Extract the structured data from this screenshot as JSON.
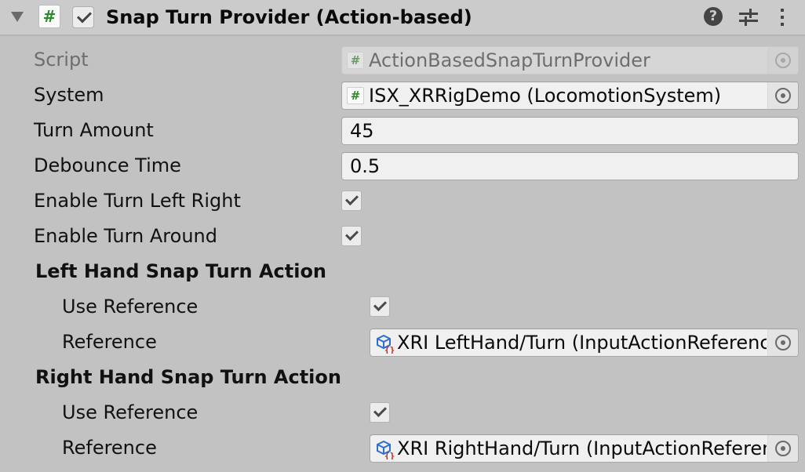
{
  "component": {
    "title": "Snap Turn Provider (Action-based)",
    "enabled": true,
    "expanded": true,
    "icons": {
      "foldout": "triangle-down-icon",
      "script": "csharp-script-icon",
      "help": "help-icon",
      "presets": "presets-sliders-icon",
      "menu": "kebab-menu-icon"
    },
    "script_icon_glyph": "#",
    "help_glyph": "?"
  },
  "fields": {
    "script": {
      "label": "Script",
      "value": "ActionBasedSnapTurnProvider",
      "disabled": true
    },
    "system": {
      "label": "System",
      "value": "ISX_XRRigDemo (LocomotionSystem)"
    },
    "turn_amount": {
      "label": "Turn Amount",
      "value": "45"
    },
    "debounce_time": {
      "label": "Debounce Time",
      "value": "0.5"
    },
    "enable_turn_left_right": {
      "label": "Enable Turn Left Right",
      "checked": true
    },
    "enable_turn_around": {
      "label": "Enable Turn Around",
      "checked": true
    }
  },
  "left_hand": {
    "header": "Left Hand Snap Turn Action",
    "use_reference": {
      "label": "Use Reference",
      "checked": true
    },
    "reference": {
      "label": "Reference",
      "value": "XRI LeftHand/Turn (InputActionReference)"
    }
  },
  "right_hand": {
    "header": "Right Hand Snap Turn Action",
    "use_reference": {
      "label": "Use Reference",
      "checked": true
    },
    "reference": {
      "label": "Reference",
      "value": "XRI RightHand/Turn (InputActionReference)"
    }
  },
  "colors": {
    "script_hash": "#2a8a2a",
    "ref_cube": "#2f6fd0",
    "ref_braces": "#cc2222"
  }
}
